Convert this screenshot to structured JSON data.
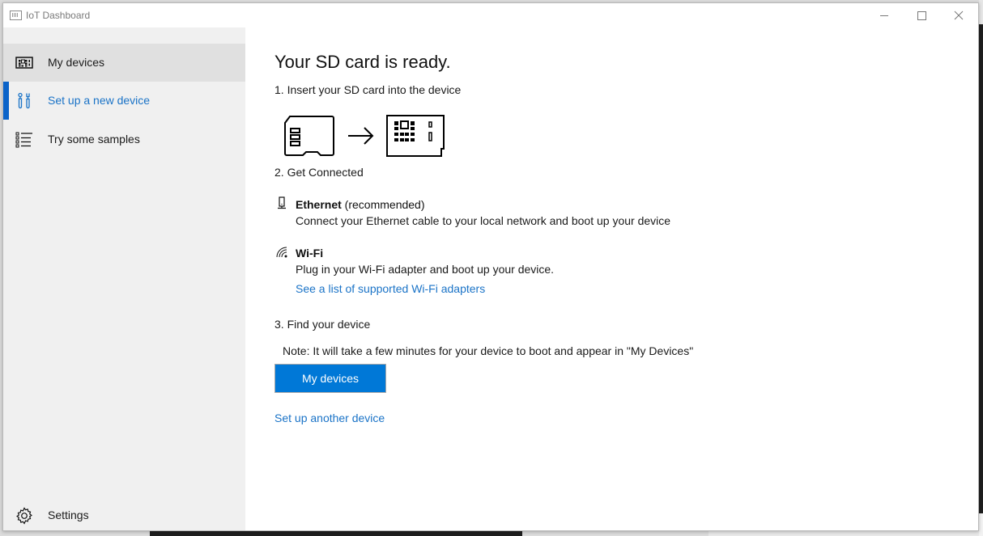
{
  "window": {
    "title": "IoT Dashboard",
    "icons": {
      "app": "iot-dashboard-app-icon",
      "minimize": "minimize-icon",
      "maximize": "maximize-icon",
      "close": "close-icon"
    }
  },
  "sidebar": {
    "items": [
      {
        "label": "My devices",
        "icon": "device-board-icon",
        "state": "hover"
      },
      {
        "label": "Set up a new device",
        "icon": "tools-icon",
        "state": "selected"
      },
      {
        "label": "Try some samples",
        "icon": "list-icon",
        "state": "normal"
      }
    ],
    "settings": {
      "label": "Settings",
      "icon": "gear-icon"
    }
  },
  "main": {
    "title": "Your SD card is ready.",
    "step1": {
      "label": "1. Insert your SD card into the device",
      "illustration": [
        "sd-card-icon",
        "arrow-right-icon",
        "device-board-icon"
      ]
    },
    "step2": {
      "label": "2. Get Connected",
      "ethernet": {
        "title": "Ethernet",
        "suffix": " (recommended)",
        "description": "Connect your Ethernet cable to your local network and boot up your device",
        "icon": "ethernet-icon"
      },
      "wifi": {
        "title": "Wi-Fi",
        "description": "Plug in your Wi-Fi adapter and boot up your device.",
        "link": "See a list of supported Wi-Fi adapters",
        "icon": "wifi-icon"
      }
    },
    "step3": {
      "label": "3. Find your device",
      "note": "Note: It will take a few minutes for your device to boot and appear in \"My Devices\"",
      "button": "My devices"
    },
    "setup_another_link": "Set up another device"
  },
  "colors": {
    "accent": "#0078d7",
    "link": "#1a73c7",
    "selection_bar": "#0a63c9",
    "sidebar_bg": "#f0f0f0",
    "sidebar_hover": "#e0e0e0"
  }
}
